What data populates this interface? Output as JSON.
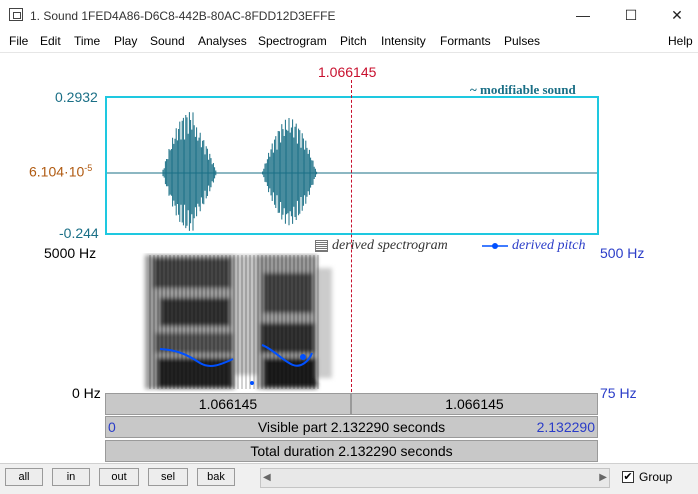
{
  "window": {
    "title": "1. Sound 1FED4A86-D6C8-442B-80AC-8FDD12D3EFFE",
    "minimize": "—",
    "maximize": "☐",
    "close": "✕"
  },
  "menu": [
    "File",
    "Edit",
    "Time",
    "Play",
    "Sound",
    "Analyses",
    "Spectrogram",
    "Pitch",
    "Intensity",
    "Formants",
    "Pulses",
    "Help"
  ],
  "cursor": {
    "time": "1.066145"
  },
  "waveform": {
    "ymax": "0.2932",
    "zero_base": "6.104·10",
    "zero_exp": "-5",
    "ymin": "-0.244",
    "legend": "~ modifiable sound"
  },
  "spectrogram": {
    "fmax": "5000 Hz",
    "fmin": "0 Hz",
    "pitch_max": "500 Hz",
    "pitch_min": "75 Hz",
    "legend_spectrogram": "derived spectrogram",
    "legend_pitch": "derived pitch"
  },
  "time_rows": {
    "left_segment": "1.066145",
    "right_segment": "1.066145",
    "visible_start": "0",
    "visible_label": "Visible part 2.132290 seconds",
    "visible_end": "2.132290",
    "total_label": "Total duration 2.132290 seconds"
  },
  "toolbar": {
    "all": "all",
    "in": "in",
    "out": "out",
    "sel": "sel",
    "bak": "bak",
    "group_label": "Group",
    "group_checked": "✔"
  },
  "colors": {
    "wave": "#1a6f86",
    "frame": "#1ec8e0",
    "cursor": "#c8102e",
    "pitch": "#0050ff"
  }
}
